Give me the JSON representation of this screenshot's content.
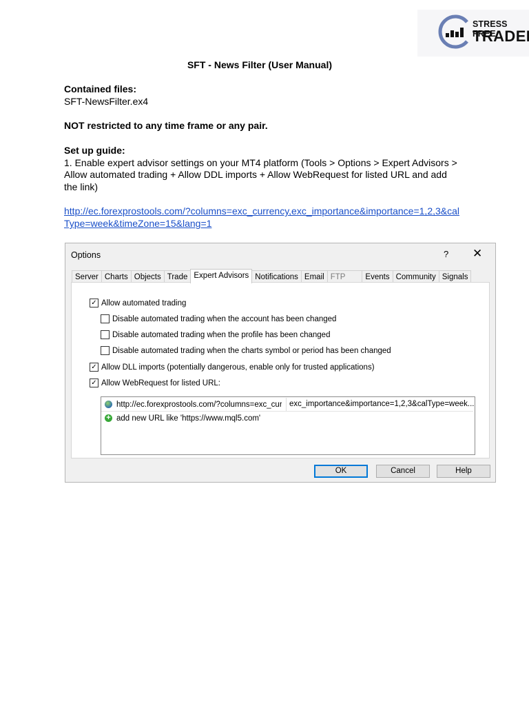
{
  "logo": {
    "line1": "STRESS FREE",
    "line2": "TRADER"
  },
  "doc": {
    "title": "SFT - News Filter (User Manual)",
    "contained_heading": "Contained files:",
    "contained_file": "SFT-NewsFilter.ex4",
    "restriction": "NOT restricted to any time frame or any pair.",
    "setup_heading": "Set up guide:",
    "step1_line1": "1. Enable expert advisor settings on your MT4 platform (Tools > Options > Expert Advisors >",
    "step1_line2": "Allow automated trading + Allow DDL imports + Allow  WebRequest for listed URL and add",
    "step1_line3": "the link)",
    "link_line1": "http://ec.forexprostools.com/?columns=exc_currency,exc_importance&importance=1,2,3&cal",
    "link_line2": "Type=week&timeZone=15&lang=1"
  },
  "dialog": {
    "title": "Options",
    "help_glyph": "?",
    "close_glyph": "✕",
    "tabs": [
      "Server",
      "Charts",
      "Objects",
      "Trade",
      "Expert Advisors",
      "Notifications",
      "Email",
      "FTP",
      "Events",
      "Community",
      "Signals"
    ],
    "active_tab": "Expert Advisors",
    "options": [
      {
        "label": "Allow automated trading",
        "checked": true
      },
      {
        "label": "Disable automated trading when the account has been changed",
        "checked": false
      },
      {
        "label": "Disable automated trading when the profile has been changed",
        "checked": false
      },
      {
        "label": "Disable automated trading when the charts symbol or period has been changed",
        "checked": false
      },
      {
        "label": "Allow DLL imports (potentially dangerous, enable only for trusted applications)",
        "checked": true
      },
      {
        "label": "Allow WebRequest for listed URL:",
        "checked": true
      }
    ],
    "url_list": {
      "url_part1": "http://ec.forexprostools.com/?columns=exc_curr...",
      "url_part2": "exc_importance&importance=1,2,3&calType=week...",
      "add_hint": "add new URL like 'https://www.mql5.com'"
    },
    "buttons": {
      "ok": "OK",
      "cancel": "Cancel",
      "help": "Help"
    }
  }
}
